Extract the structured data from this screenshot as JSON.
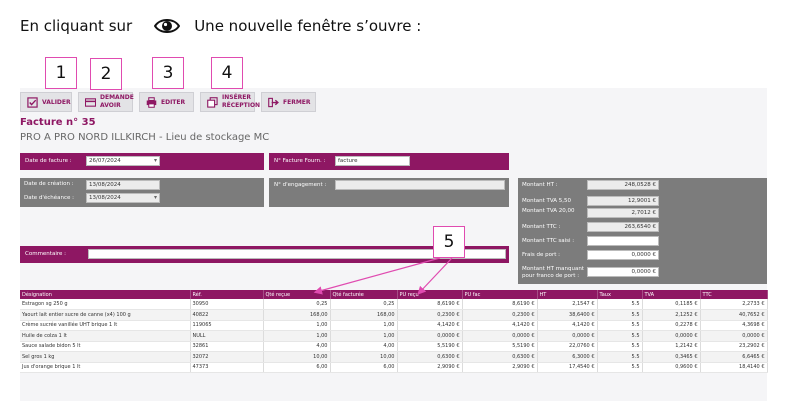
{
  "intro": {
    "prefix": "En cliquant sur",
    "icon": "eye-icon",
    "suffix": "Une nouvelle fenêtre s’ouvre :"
  },
  "toolbar": {
    "valider": "VALIDER",
    "demande_avoir_1": "DEMANDE",
    "demande_avoir_2": "AVOIR",
    "editer": "EDITER",
    "inserer_1": "INSÉRER",
    "inserer_2": "RÉCEPTION",
    "fermer": "FERMER"
  },
  "callouts": [
    "1",
    "2",
    "3",
    "4",
    "5"
  ],
  "header": {
    "title": "Facture n° 35",
    "subtitle": "PRO A PRO NORD ILLKIRCH - Lieu de stockage MC"
  },
  "form": {
    "date_facture_label": "Date de facture :",
    "date_facture_value": "26/07/2024",
    "num_facture_label": "N° Facture Fourn. :",
    "num_facture_value": "facture",
    "date_creation_label": "Date de création :",
    "date_creation_value": "13/08/2024",
    "date_echeance_label": "Date d'échéance :",
    "date_echeance_value": "13/08/2024",
    "engagement_label": "N° d'engagement :",
    "engagement_value": "",
    "commentaire_label": "Commentaire :",
    "commentaire_value": ""
  },
  "totals": {
    "ht_label": "Montant HT :",
    "ht_value": "248,0528 €",
    "tva55_label": "Montant TVA 5,50",
    "tva55_value": "12,9001 €",
    "tva20_label": "Montant TVA 20,00",
    "tva20_value": "2,7012 €",
    "ttc_label": "Montant TTC :",
    "ttc_value": "263,6540 €",
    "ttc_saisi_label": "Montant TTC saisi :",
    "ttc_saisi_value": "",
    "port_label": "Frais de port :",
    "port_value": "0,0000 €",
    "franco_label_1": "Montant HT manquant",
    "franco_label_2": "pour franco de port :",
    "franco_value": "0,0000 €"
  },
  "table": {
    "columns": [
      "Désignation",
      "Réf.",
      "Qté reçue",
      "Qté facturée",
      "PU reçu",
      "PU fac",
      "HT",
      "Taux",
      "TVA",
      "TTC"
    ],
    "rows": [
      [
        "Estragon sg 250 g",
        "30950",
        "0,25",
        "0,25",
        "8,6190 €",
        "8,6190 €",
        "2,1547 €",
        "5.5",
        "0,1185 €",
        "2,2733 €"
      ],
      [
        "Yaourt lait entier sucre de canne (x4) 100 g",
        "40822",
        "168,00",
        "168,00",
        "0,2300 €",
        "0,2300 €",
        "38,6400 €",
        "5.5",
        "2,1252 €",
        "40,7652 €"
      ],
      [
        "Crème sucrée vanillée UHT brique 1 lt",
        "119065",
        "1,00",
        "1,00",
        "4,1420 €",
        "4,1420 €",
        "4,1420 €",
        "5.5",
        "0,2278 €",
        "4,3698 €"
      ],
      [
        "Huile de colza 1 lt",
        "NULL",
        "1,00",
        "1,00",
        "0,0000 €",
        "0,0000 €",
        "0,0000 €",
        "5.5",
        "0,0000 €",
        "0,0000 €"
      ],
      [
        "Sauce salade bidon 5 lt",
        "32861",
        "4,00",
        "4,00",
        "5,5190 €",
        "5,5190 €",
        "22,0760 €",
        "5.5",
        "1,2142 €",
        "23,2902 €"
      ],
      [
        "Sel gros 1 kg",
        "32072",
        "10,00",
        "10,00",
        "0,6300 €",
        "0,6300 €",
        "6,3000 €",
        "5.5",
        "0,3465 €",
        "6,6465 €"
      ],
      [
        "Jus d'orange brique 1 lt",
        "47373",
        "6,00",
        "6,00",
        "2,9090 €",
        "2,9090 €",
        "17,4540 €",
        "5.5",
        "0,9600 €",
        "18,4140 €"
      ]
    ]
  }
}
